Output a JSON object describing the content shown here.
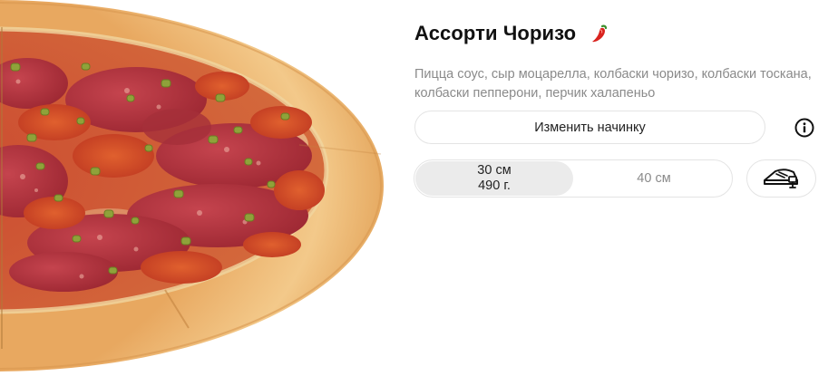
{
  "product": {
    "title": "Ассорти Чоризо",
    "spicy_icon": "chili-pepper-icon",
    "description": "Пицца соус, сыр моцарелла, колбаски чоризо, колбаски тоскана, колбаски пепперони, перчик халапеньо",
    "change_filling_label": "Изменить начинку",
    "info_icon": "info-icon"
  },
  "sizes": [
    {
      "label": "30 см",
      "weight": "490 г.",
      "selected": true
    },
    {
      "label": "40 см",
      "selected": false
    }
  ],
  "box_icon": "pizza-box-icon",
  "colors": {
    "pepper_red": "#d9231f",
    "pepper_stem": "#3c8f2c",
    "active_size_bg": "#ebebeb"
  }
}
